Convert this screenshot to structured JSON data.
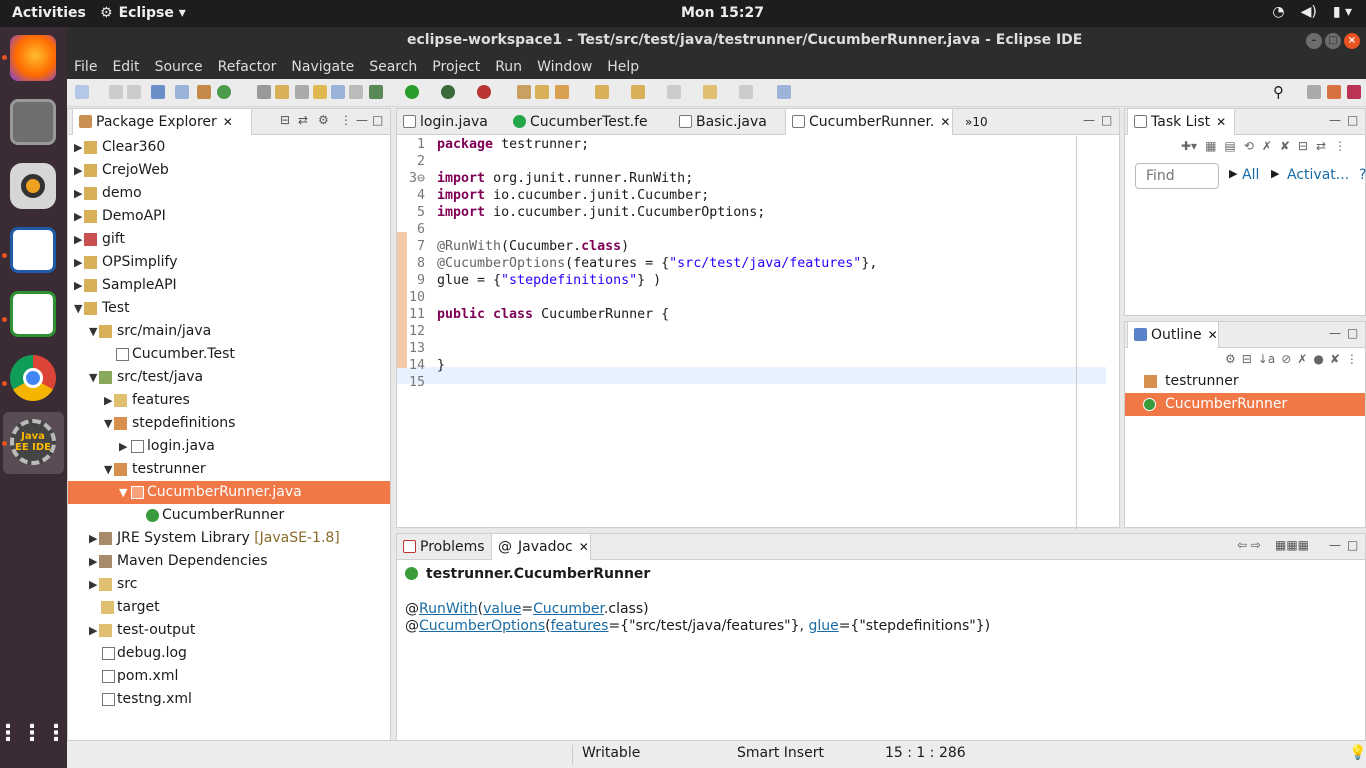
{
  "topbar": {
    "activities": "Activities",
    "app": "Eclipse",
    "clock": "Mon 15:27"
  },
  "window": {
    "title": "eclipse-workspace1 - Test/src/test/java/testrunner/CucumberRunner.java - Eclipse IDE"
  },
  "menu": [
    "File",
    "Edit",
    "Source",
    "Refactor",
    "Navigate",
    "Search",
    "Project",
    "Run",
    "Window",
    "Help"
  ],
  "package_explorer": {
    "title": "Package Explorer",
    "items": [
      {
        "label": "Clear360",
        "extra": ""
      },
      {
        "label": "CrejoWeb",
        "extra": ""
      },
      {
        "label": "demo",
        "extra": ""
      },
      {
        "label": "DemoAPI",
        "extra": ""
      },
      {
        "label": "gift",
        "extra": ""
      },
      {
        "label": "OPSimplify",
        "extra": ""
      },
      {
        "label": "SampleAPI",
        "extra": ""
      },
      {
        "label": "Test",
        "extra": ""
      },
      {
        "label": "src/main/java",
        "extra": ""
      },
      {
        "label": "Cucumber.Test",
        "extra": ""
      },
      {
        "label": "src/test/java",
        "extra": ""
      },
      {
        "label": "features",
        "extra": ""
      },
      {
        "label": "stepdefinitions",
        "extra": ""
      },
      {
        "label": "login.java",
        "extra": ""
      },
      {
        "label": "testrunner",
        "extra": ""
      },
      {
        "label": "CucumberRunner.java",
        "extra": ""
      },
      {
        "label": "CucumberRunner",
        "extra": ""
      },
      {
        "label": "JRE System Library",
        "extra": "[JavaSE-1.8]"
      },
      {
        "label": "Maven Dependencies",
        "extra": ""
      },
      {
        "label": "src",
        "extra": ""
      },
      {
        "label": "target",
        "extra": ""
      },
      {
        "label": "test-output",
        "extra": ""
      },
      {
        "label": "debug.log",
        "extra": ""
      },
      {
        "label": "pom.xml",
        "extra": ""
      },
      {
        "label": "testng.xml",
        "extra": ""
      }
    ]
  },
  "editor": {
    "tabs": [
      "login.java",
      "CucumberTest.fe",
      "Basic.java",
      "CucumberRunner."
    ],
    "overflow": "»10",
    "lines": [
      {
        "n": "1",
        "parts": [
          [
            "kw",
            "package"
          ],
          [
            "",
            "testrunner;"
          ]
        ]
      },
      {
        "n": "2",
        "parts": []
      },
      {
        "n": "3⊖",
        "parts": [
          [
            "kw",
            "import"
          ],
          [
            "",
            "org.junit.runner.RunWith;"
          ]
        ]
      },
      {
        "n": "4",
        "parts": [
          [
            "kw",
            "import"
          ],
          [
            "",
            "io.cucumber.junit.Cucumber;"
          ]
        ]
      },
      {
        "n": "5",
        "parts": [
          [
            "kw",
            "import"
          ],
          [
            "",
            "io.cucumber.junit.CucumberOptions;"
          ]
        ]
      },
      {
        "n": "6",
        "parts": []
      },
      {
        "n": "7",
        "parts": [
          [
            "an",
            "@RunWith"
          ],
          [
            "",
            "(Cucumber."
          ],
          [
            "kw",
            "class"
          ],
          [
            "",
            ")"
          ]
        ]
      },
      {
        "n": "8",
        "parts": [
          [
            "an",
            "@CucumberOptions"
          ],
          [
            "",
            "(features = {"
          ],
          [
            "st",
            "\"src/test/java/features\""
          ],
          [
            "",
            "},"
          ]
        ]
      },
      {
        "n": "9",
        "parts": [
          [
            "",
            "glue = {"
          ],
          [
            "st",
            "\"stepdefinitions\""
          ],
          [
            "",
            "} )"
          ]
        ]
      },
      {
        "n": "10",
        "parts": []
      },
      {
        "n": "11",
        "parts": [
          [
            "kw",
            "public class"
          ],
          [
            "",
            "CucumberRunner {"
          ]
        ]
      },
      {
        "n": "12",
        "parts": []
      },
      {
        "n": "13",
        "parts": []
      },
      {
        "n": "14",
        "parts": [
          [
            "",
            "}"
          ]
        ]
      },
      {
        "n": "15",
        "parts": []
      }
    ]
  },
  "task_list": {
    "title": "Task List",
    "find_placeholder": "Find",
    "all": "All",
    "activate": "Activat..."
  },
  "outline": {
    "title": "Outline",
    "items": [
      "testrunner",
      "CucumberRunner"
    ]
  },
  "bottom": {
    "tabs": [
      "Problems",
      "Javadoc"
    ],
    "heading": "testrunner.CucumberRunner",
    "line1": {
      "at": "@",
      "RunWith": "RunWith",
      "paren": "(",
      "value": "value",
      "eq": "=",
      "Cucumber": "Cucumber",
      "tail": ".class)"
    },
    "line2": {
      "at": "@",
      "CucumberOptions": "CucumberOptions",
      "paren": "(",
      "features": "features",
      "eq": "={\"src/test/java/features\"}, ",
      "glue": "glue",
      "tail": "={\"stepdefinitions\"})"
    }
  },
  "status": {
    "writable": "Writable",
    "insert": "Smart Insert",
    "pos": "15 : 1 : 286"
  }
}
